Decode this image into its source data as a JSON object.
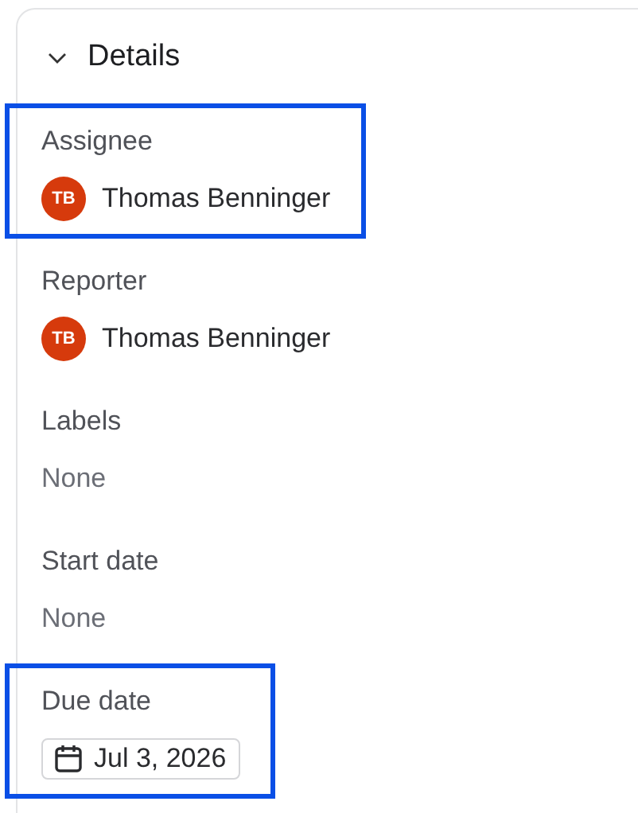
{
  "section": {
    "title": "Details",
    "expanded": true
  },
  "fields": [
    {
      "kind": "person",
      "label": "Assignee",
      "initials": "TB",
      "value": "Thomas Benninger",
      "color": "#d63a0c",
      "highlighted": true
    },
    {
      "kind": "person",
      "label": "Reporter",
      "initials": "TB",
      "value": "Thomas Benninger",
      "color": "#d63a0c",
      "highlighted": false
    },
    {
      "kind": "empty",
      "label": "Labels",
      "value": "None",
      "highlighted": false
    },
    {
      "kind": "empty",
      "label": "Start date",
      "value": "None",
      "highlighted": false
    },
    {
      "kind": "date",
      "label": "Due date",
      "value": "Jul 3, 2026",
      "highlighted": true
    }
  ]
}
